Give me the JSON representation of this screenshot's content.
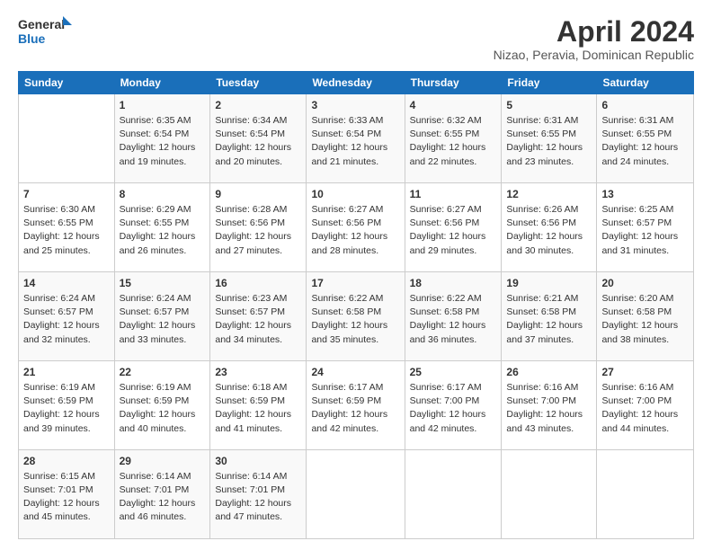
{
  "logo": {
    "line1": "General",
    "line2": "Blue"
  },
  "header": {
    "title": "April 2024",
    "location": "Nizao, Peravia, Dominican Republic"
  },
  "weekdays": [
    "Sunday",
    "Monday",
    "Tuesday",
    "Wednesday",
    "Thursday",
    "Friday",
    "Saturday"
  ],
  "weeks": [
    [
      {
        "day": "",
        "info": ""
      },
      {
        "day": "1",
        "info": "Sunrise: 6:35 AM\nSunset: 6:54 PM\nDaylight: 12 hours\nand 19 minutes."
      },
      {
        "day": "2",
        "info": "Sunrise: 6:34 AM\nSunset: 6:54 PM\nDaylight: 12 hours\nand 20 minutes."
      },
      {
        "day": "3",
        "info": "Sunrise: 6:33 AM\nSunset: 6:54 PM\nDaylight: 12 hours\nand 21 minutes."
      },
      {
        "day": "4",
        "info": "Sunrise: 6:32 AM\nSunset: 6:55 PM\nDaylight: 12 hours\nand 22 minutes."
      },
      {
        "day": "5",
        "info": "Sunrise: 6:31 AM\nSunset: 6:55 PM\nDaylight: 12 hours\nand 23 minutes."
      },
      {
        "day": "6",
        "info": "Sunrise: 6:31 AM\nSunset: 6:55 PM\nDaylight: 12 hours\nand 24 minutes."
      }
    ],
    [
      {
        "day": "7",
        "info": "Sunrise: 6:30 AM\nSunset: 6:55 PM\nDaylight: 12 hours\nand 25 minutes."
      },
      {
        "day": "8",
        "info": "Sunrise: 6:29 AM\nSunset: 6:55 PM\nDaylight: 12 hours\nand 26 minutes."
      },
      {
        "day": "9",
        "info": "Sunrise: 6:28 AM\nSunset: 6:56 PM\nDaylight: 12 hours\nand 27 minutes."
      },
      {
        "day": "10",
        "info": "Sunrise: 6:27 AM\nSunset: 6:56 PM\nDaylight: 12 hours\nand 28 minutes."
      },
      {
        "day": "11",
        "info": "Sunrise: 6:27 AM\nSunset: 6:56 PM\nDaylight: 12 hours\nand 29 minutes."
      },
      {
        "day": "12",
        "info": "Sunrise: 6:26 AM\nSunset: 6:56 PM\nDaylight: 12 hours\nand 30 minutes."
      },
      {
        "day": "13",
        "info": "Sunrise: 6:25 AM\nSunset: 6:57 PM\nDaylight: 12 hours\nand 31 minutes."
      }
    ],
    [
      {
        "day": "14",
        "info": "Sunrise: 6:24 AM\nSunset: 6:57 PM\nDaylight: 12 hours\nand 32 minutes."
      },
      {
        "day": "15",
        "info": "Sunrise: 6:24 AM\nSunset: 6:57 PM\nDaylight: 12 hours\nand 33 minutes."
      },
      {
        "day": "16",
        "info": "Sunrise: 6:23 AM\nSunset: 6:57 PM\nDaylight: 12 hours\nand 34 minutes."
      },
      {
        "day": "17",
        "info": "Sunrise: 6:22 AM\nSunset: 6:58 PM\nDaylight: 12 hours\nand 35 minutes."
      },
      {
        "day": "18",
        "info": "Sunrise: 6:22 AM\nSunset: 6:58 PM\nDaylight: 12 hours\nand 36 minutes."
      },
      {
        "day": "19",
        "info": "Sunrise: 6:21 AM\nSunset: 6:58 PM\nDaylight: 12 hours\nand 37 minutes."
      },
      {
        "day": "20",
        "info": "Sunrise: 6:20 AM\nSunset: 6:58 PM\nDaylight: 12 hours\nand 38 minutes."
      }
    ],
    [
      {
        "day": "21",
        "info": "Sunrise: 6:19 AM\nSunset: 6:59 PM\nDaylight: 12 hours\nand 39 minutes."
      },
      {
        "day": "22",
        "info": "Sunrise: 6:19 AM\nSunset: 6:59 PM\nDaylight: 12 hours\nand 40 minutes."
      },
      {
        "day": "23",
        "info": "Sunrise: 6:18 AM\nSunset: 6:59 PM\nDaylight: 12 hours\nand 41 minutes."
      },
      {
        "day": "24",
        "info": "Sunrise: 6:17 AM\nSunset: 6:59 PM\nDaylight: 12 hours\nand 42 minutes."
      },
      {
        "day": "25",
        "info": "Sunrise: 6:17 AM\nSunset: 7:00 PM\nDaylight: 12 hours\nand 42 minutes."
      },
      {
        "day": "26",
        "info": "Sunrise: 6:16 AM\nSunset: 7:00 PM\nDaylight: 12 hours\nand 43 minutes."
      },
      {
        "day": "27",
        "info": "Sunrise: 6:16 AM\nSunset: 7:00 PM\nDaylight: 12 hours\nand 44 minutes."
      }
    ],
    [
      {
        "day": "28",
        "info": "Sunrise: 6:15 AM\nSunset: 7:01 PM\nDaylight: 12 hours\nand 45 minutes."
      },
      {
        "day": "29",
        "info": "Sunrise: 6:14 AM\nSunset: 7:01 PM\nDaylight: 12 hours\nand 46 minutes."
      },
      {
        "day": "30",
        "info": "Sunrise: 6:14 AM\nSunset: 7:01 PM\nDaylight: 12 hours\nand 47 minutes."
      },
      {
        "day": "",
        "info": ""
      },
      {
        "day": "",
        "info": ""
      },
      {
        "day": "",
        "info": ""
      },
      {
        "day": "",
        "info": ""
      }
    ]
  ]
}
